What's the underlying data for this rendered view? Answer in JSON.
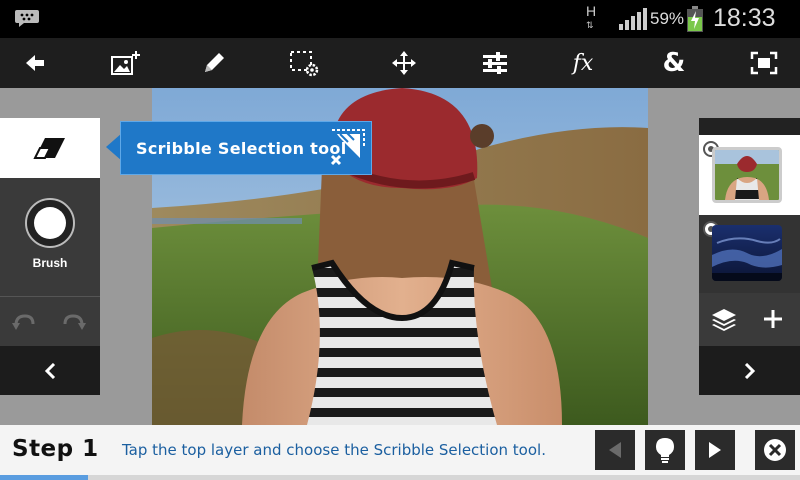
{
  "status_bar": {
    "network": "H",
    "battery_percent": "59%",
    "time": "18:33"
  },
  "toolbar": {
    "items": [
      {
        "name": "back-arrow-icon"
      },
      {
        "name": "add-image-icon"
      },
      {
        "name": "pencil-icon"
      },
      {
        "name": "selection-settings-icon"
      },
      {
        "name": "move-icon"
      },
      {
        "name": "adjustments-icon"
      },
      {
        "name": "fx-icon",
        "label": "fx"
      },
      {
        "name": "blend-icon",
        "label": "&"
      },
      {
        "name": "fit-screen-icon"
      }
    ]
  },
  "tooltip": {
    "text": "Scribble Selection tool"
  },
  "left_panel": {
    "brush_label": "Brush"
  },
  "stepbar": {
    "step_label": "Step 1",
    "instruction": "Tap the top layer and choose the Scribble Selection tool.",
    "progress": 0.11
  },
  "colors": {
    "accent": "#1f78c8",
    "progress": "#5a9de0",
    "instruction_text": "#1b5fa0"
  }
}
